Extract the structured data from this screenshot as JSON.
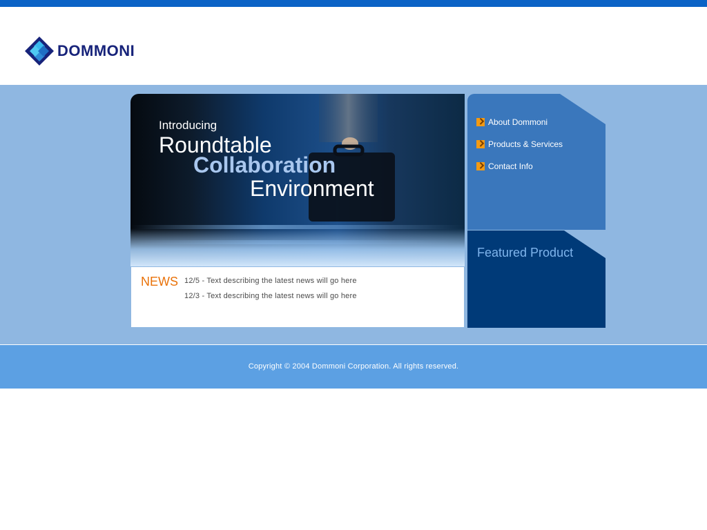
{
  "brand": {
    "name": "DOMMONI",
    "colors": {
      "top_bar": "#0b63c6",
      "logo_text": "#17237a",
      "accent_orange": "#e9720a",
      "band": "#8fb7e1",
      "footer": "#5ca0e3",
      "featured_bg": "#003a78"
    }
  },
  "hero": {
    "intro": "Introducing",
    "line1": "Roundtable",
    "line2": "Collaboration",
    "line3": "Environment"
  },
  "news": {
    "label": "NEWS",
    "items": [
      "12/5 - Text describing the latest news will go here",
      "12/3 - Text describing the latest news will go here"
    ]
  },
  "nav": {
    "items": [
      {
        "label": "About Dommoni",
        "icon": "arrow-right-icon"
      },
      {
        "label": "Products & Services",
        "icon": "arrow-right-icon"
      },
      {
        "label": "Contact Info",
        "icon": "arrow-right-icon"
      }
    ]
  },
  "featured": {
    "title": "Featured Product"
  },
  "footer": {
    "copyright": "Copyright © 2004 Dommoni Corporation. All rights reserved."
  }
}
